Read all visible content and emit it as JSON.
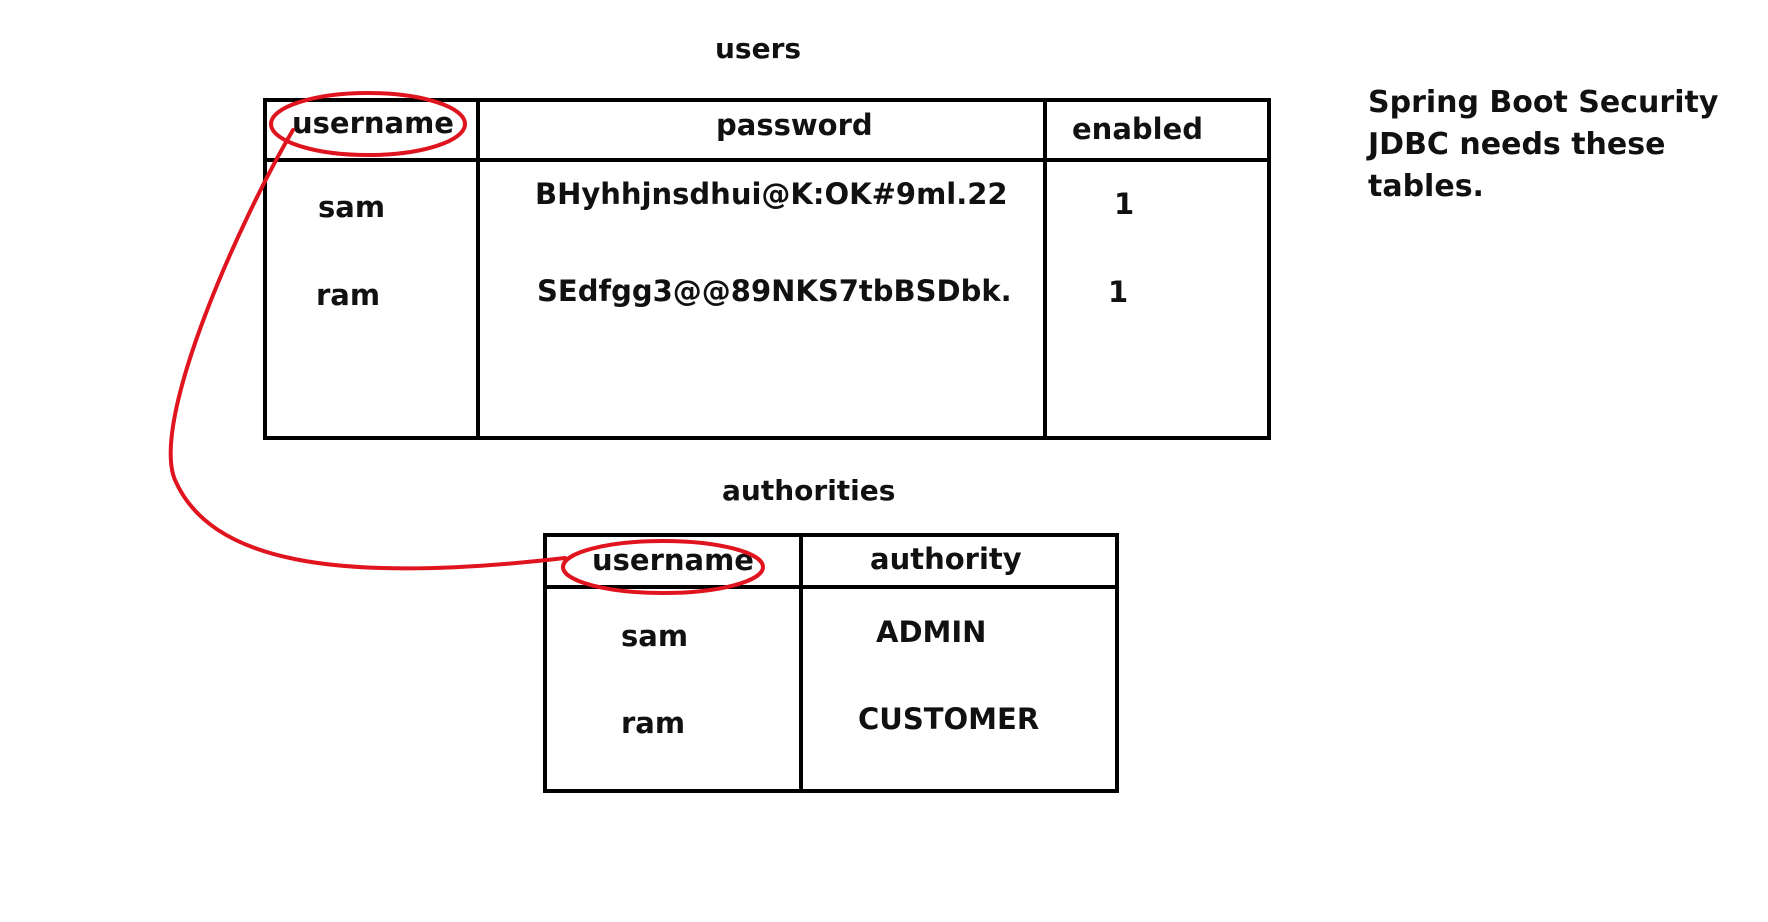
{
  "users_table": {
    "title": "users",
    "columns": [
      "username",
      "password",
      "enabled"
    ],
    "rows": [
      [
        "sam",
        "BHyhhjnsdhui@K:OK#9ml.22",
        "1"
      ],
      [
        "ram",
        "SEdfgg3@@89NKS7tbBSDbk.",
        "1"
      ]
    ]
  },
  "authorities_table": {
    "title": "authorities",
    "columns": [
      "username",
      "authority"
    ],
    "rows": [
      [
        "sam",
        "ADMIN"
      ],
      [
        "ram",
        "CUSTOMER"
      ]
    ]
  },
  "note": "Spring Boot Security JDBC needs these tables.",
  "colors": {
    "annotation": "#e0141e",
    "ink": "#111111",
    "border": "#000000"
  }
}
